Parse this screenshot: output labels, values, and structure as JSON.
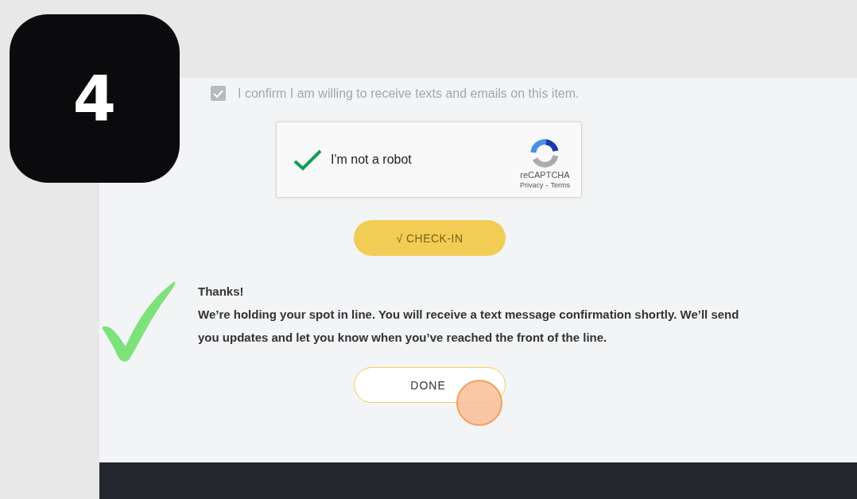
{
  "step_badge": "4",
  "consent": {
    "label": "I confirm I am willing to receive texts and emails on this item.",
    "checked": true,
    "disabled": true
  },
  "captcha": {
    "label": "I'm not a robot",
    "verified": true,
    "brand": "reCAPTCHA",
    "links": [
      "Privacy",
      "Terms"
    ],
    "separator": "-"
  },
  "checkin_button": {
    "label": "√ CHECK-IN",
    "disabled": true
  },
  "message": {
    "title": "Thanks!",
    "body": "We’re holding your spot in line. You will receive a text message confirmation shortly. We’ll send you updates and let you know when you’ve reached the front of the line."
  },
  "done_button": {
    "label": "DONE",
    "clicked": true
  }
}
